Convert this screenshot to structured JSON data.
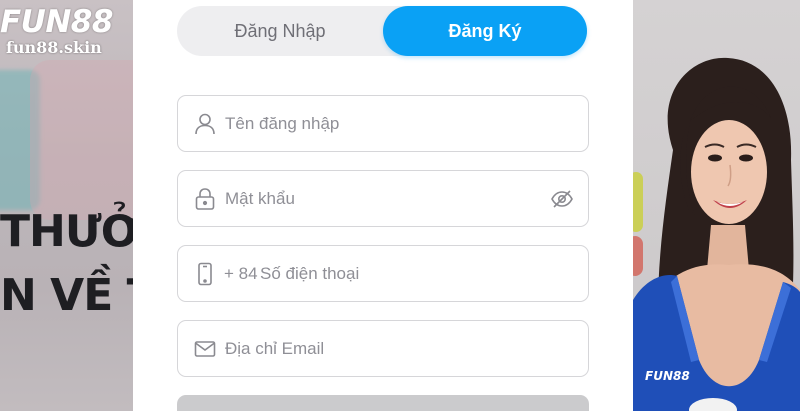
{
  "background": {
    "logo_text": "FUN88",
    "domain_text": "fun88.skin",
    "banner_lines": [
      "THƯỞ",
      "N VỀ TA"
    ]
  },
  "auth_tabs": {
    "login_label": "Đăng Nhập",
    "register_label": "Đăng Ký",
    "active_tab": "register"
  },
  "form": {
    "username": {
      "value": "",
      "placeholder": "Tên đăng nhập",
      "icon": "user-icon"
    },
    "password": {
      "value": "",
      "placeholder": "Mật khẩu",
      "icon": "lock-icon",
      "toggle_icon": "eye-slash-icon"
    },
    "phone": {
      "prefix": "+ 84",
      "value": "",
      "placeholder": "Số điện thoại",
      "icon": "phone-icon"
    },
    "email": {
      "value": "",
      "placeholder": "Địa chỉ Email",
      "icon": "mail-icon"
    }
  },
  "colors": {
    "accent": "#0aa1f5",
    "tab_track": "#eeeef0",
    "field_border": "#d6d6d9",
    "placeholder": "#8f8f96",
    "submit_disabled": "#cbcbcd"
  }
}
